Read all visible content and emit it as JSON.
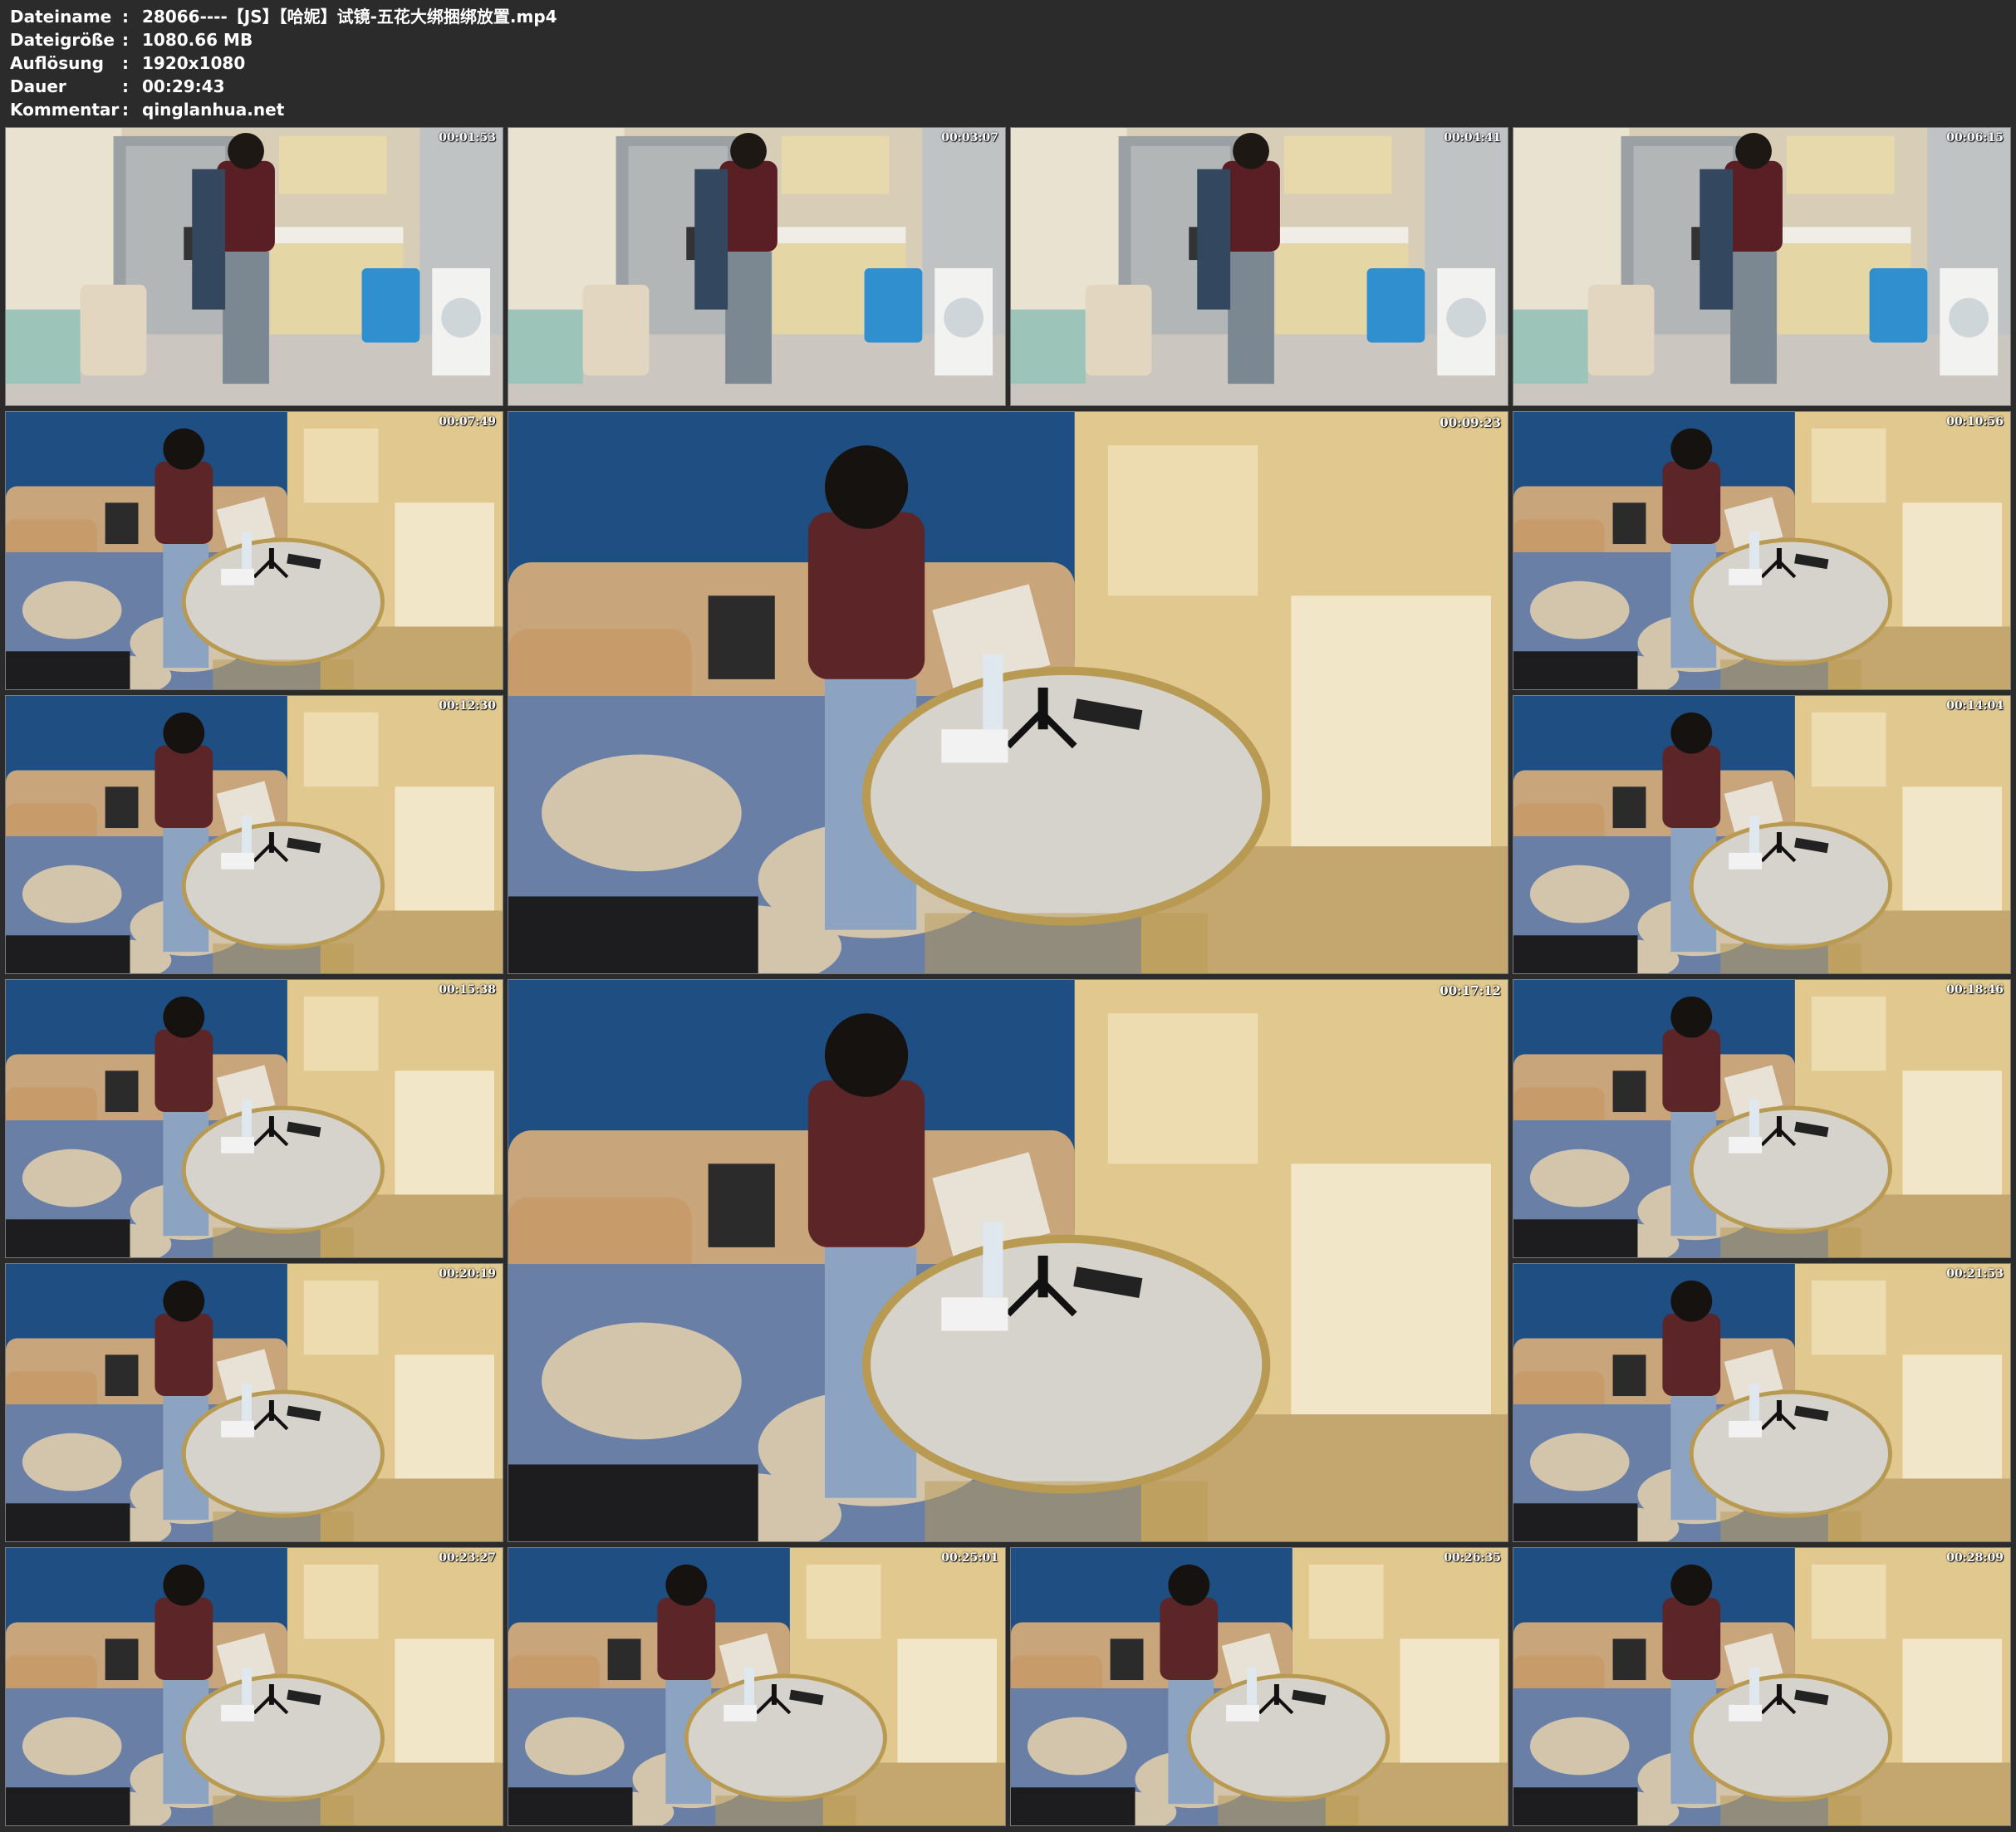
{
  "header": {
    "rows": [
      {
        "label": "Dateiname",
        "sep": ":",
        "value": "28066----【JS】【哈妮】试镜-五花大绑捆绑放置.mp4"
      },
      {
        "label": "Dateigröße",
        "sep": ":",
        "value": "1080.66 MB"
      },
      {
        "label": "Auflösung",
        "sep": ":",
        "value": "1920x1080"
      },
      {
        "label": "Dauer",
        "sep": ":",
        "value": "00:29:43"
      },
      {
        "label": "Kommentar",
        "sep": ":",
        "value": "qinglanhua.net"
      }
    ]
  },
  "frames": [
    {
      "timestamp": "00:01:53",
      "scene": "kitchen"
    },
    {
      "timestamp": "00:03:07",
      "scene": "kitchen"
    },
    {
      "timestamp": "00:04:41",
      "scene": "kitchen"
    },
    {
      "timestamp": "00:06:15",
      "scene": "kitchen"
    },
    {
      "timestamp": "00:07:49",
      "scene": "sofa"
    },
    {
      "timestamp": "00:09:23",
      "scene": "sofa"
    },
    {
      "timestamp": "00:10:56",
      "scene": "sofa"
    },
    {
      "timestamp": "00:12:30",
      "scene": "sofa"
    },
    {
      "timestamp": "00:14:04",
      "scene": "sofa"
    },
    {
      "timestamp": "00:15:38",
      "scene": "sofa"
    },
    {
      "timestamp": "00:17:12",
      "scene": "sofa"
    },
    {
      "timestamp": "00:18:46",
      "scene": "sofa"
    },
    {
      "timestamp": "00:20:19",
      "scene": "sofa"
    },
    {
      "timestamp": "00:21:53",
      "scene": "sofa"
    },
    {
      "timestamp": "00:23:27",
      "scene": "sofa"
    },
    {
      "timestamp": "00:25:01",
      "scene": "sofa"
    },
    {
      "timestamp": "00:26:35",
      "scene": "sofa"
    },
    {
      "timestamp": "00:28:09",
      "scene": "sofa"
    }
  ]
}
